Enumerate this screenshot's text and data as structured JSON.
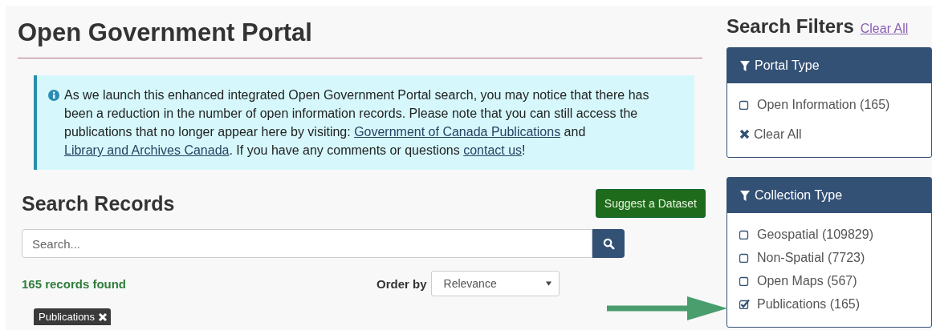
{
  "page_title": "Open Government Portal",
  "notice": {
    "segments": [
      {
        "kind": "text",
        "text": "As we launch this enhanced integrated Open Government Portal search, you may notice that there has been a reduction in the number of open information records. Please note that you can still access the publications that no longer appear here by visiting: "
      },
      {
        "kind": "link",
        "text": "Government of Canada Publications"
      },
      {
        "kind": "text",
        "text": " and "
      },
      {
        "kind": "link",
        "text": "Library and Archives Canada"
      },
      {
        "kind": "text",
        "text": ". If you have any comments or questions "
      },
      {
        "kind": "link",
        "text": "contact us"
      },
      {
        "kind": "text",
        "text": "!"
      }
    ]
  },
  "search_records": {
    "heading": "Search Records",
    "suggest_button": "Suggest a Dataset",
    "search": {
      "placeholder": "Search..."
    },
    "results_count": "165 records found",
    "order_by": {
      "label": "Order by",
      "value": "Relevance"
    },
    "active_filters": [
      {
        "label": "Publications"
      }
    ]
  },
  "sidebar": {
    "heading": "Search Filters",
    "clear_all": "Clear All",
    "groups": [
      {
        "title": "Portal Type",
        "items": [
          {
            "kind": "checkbox",
            "label": "Open Information (165)",
            "checked": false
          },
          {
            "kind": "clear",
            "label": "Clear All"
          }
        ]
      },
      {
        "title": "Collection Type",
        "items": [
          {
            "kind": "checkbox",
            "label": "Geospatial (109829)",
            "checked": false
          },
          {
            "kind": "checkbox",
            "label": "Non-Spatial (7723)",
            "checked": false
          },
          {
            "kind": "checkbox",
            "label": "Open Maps (567)",
            "checked": false
          },
          {
            "kind": "checkbox",
            "label": "Publications (165)",
            "checked": true
          }
        ]
      }
    ]
  }
}
